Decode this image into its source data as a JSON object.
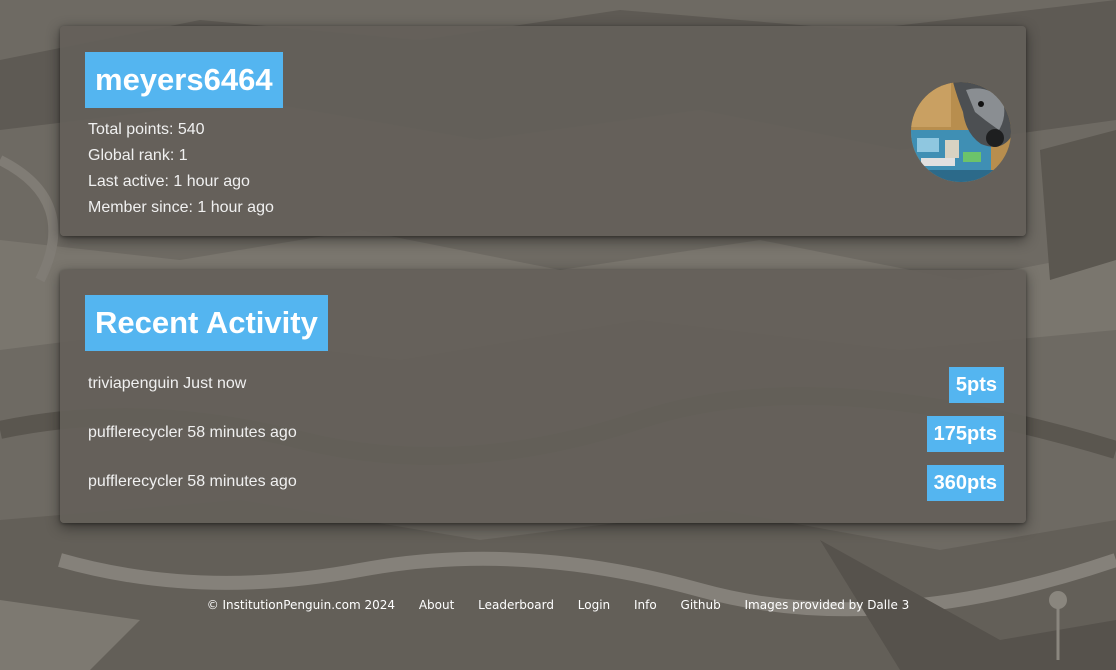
{
  "profile": {
    "username": "meyers6464",
    "stats": [
      "Total points: 540",
      "Global rank: 1",
      "Last active: 1 hour ago",
      "Member since: 1 hour ago"
    ]
  },
  "activity": {
    "title": "Recent Activity",
    "items": [
      {
        "text": "triviapenguin Just now",
        "points": "5pts"
      },
      {
        "text": "pufflerecycler 58 minutes ago",
        "points": "175pts"
      },
      {
        "text": "pufflerecycler 58 minutes ago",
        "points": "360pts"
      }
    ]
  },
  "footer": {
    "copyright": "© InstitutionPenguin.com 2024",
    "links": [
      "About",
      "Leaderboard",
      "Login",
      "Info",
      "Github"
    ],
    "credit": "Images provided by Dalle 3"
  },
  "colors": {
    "accent": "#54b5f0",
    "card": "#645f59",
    "background": "#6e6b65"
  }
}
